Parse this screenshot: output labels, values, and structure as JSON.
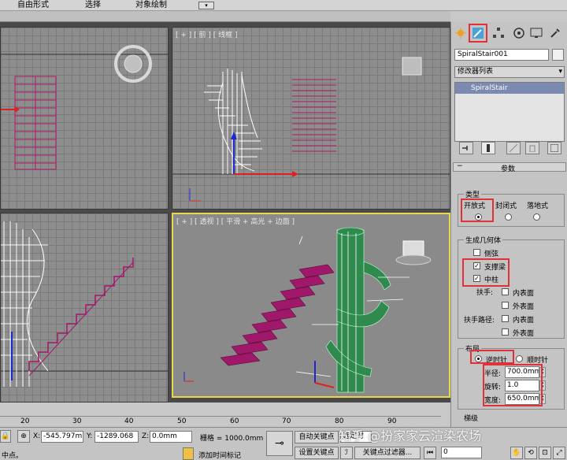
{
  "menubar": {
    "items": [
      "自由形式",
      "选择",
      "对象绘制"
    ]
  },
  "viewports": {
    "front_label": "[ + ] [ 前 ] [ 线框 ]",
    "persp_label": "[ + ] [ 透视 ] [ 平滑 + 高光 + 边面 ]"
  },
  "command_panel": {
    "tabs": [
      "create-icon",
      "modify-icon",
      "hierarchy-icon",
      "motion-icon",
      "display-icon",
      "utilities-icon"
    ],
    "object_name": "SpiralStair001",
    "modifier_list": "修改器列表",
    "stack_item": "SpiralStair",
    "rollout_title": "参数",
    "type_group": {
      "title": "类型",
      "options": [
        "开放式",
        "封闭式",
        "落地式"
      ],
      "selected": "开放式"
    },
    "geometry_group": {
      "title": "生成几何体",
      "side_string": "侧弦",
      "carriage": "支撑梁",
      "center_pole": "中柱",
      "handrail_label": "扶手:",
      "handrail_path_label": "扶手路径:",
      "inside": "内表面",
      "outside": "外表面"
    },
    "layout_group": {
      "title": "布局",
      "ccw": "逆时针",
      "cw": "顺时针",
      "radius_label": "半径:",
      "radius_value": "700.0mm",
      "revs_label": "旋转:",
      "revs_value": "1.0",
      "width_label": "宽度:",
      "width_value": "650.0mm"
    },
    "rise_group_title": "梯级"
  },
  "ruler": {
    "ticks": [
      "20",
      "30",
      "40",
      "50",
      "60",
      "70",
      "80",
      "90"
    ]
  },
  "statusbar": {
    "x_label": "X:",
    "x_value": "-545.797m",
    "y_label": "Y:",
    "y_value": "-1289.068",
    "z_label": "Z:",
    "z_value": "0.0mm",
    "grid": "栅格 = 1000.0mm",
    "autokey": "自动关键点",
    "selected": "选定对",
    "setkey": "设置关键点",
    "keyfilters": "关键点过滤器...",
    "add_time_tag": "添加时间标记",
    "prompt": "中点。",
    "frame": "0"
  },
  "watermark": "知乎 @扮家家云渲染农场",
  "colors": {
    "highlight_box": "#e0303a",
    "stair_magenta": "#a0186a",
    "pole_green": "#2f8a4e",
    "active_viewport": "#e8d850"
  }
}
